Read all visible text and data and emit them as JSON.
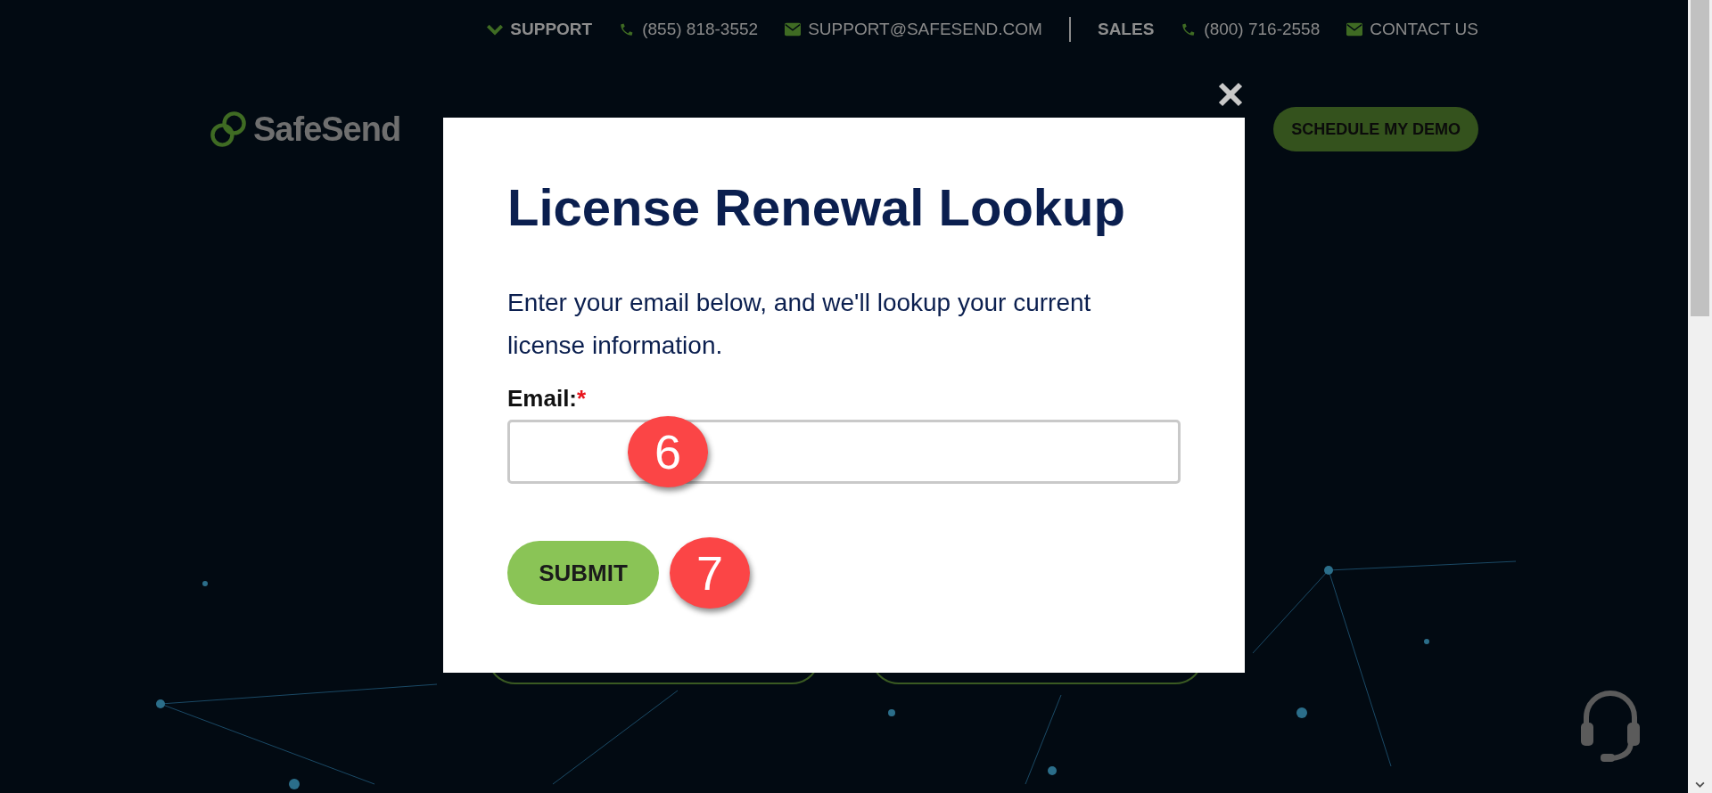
{
  "topbar": [
    {
      "kind": "toggle",
      "text": "SUPPORT"
    },
    {
      "kind": "phone",
      "text": "(855) 818-3552"
    },
    {
      "kind": "email",
      "text": "SUPPORT@SAFESEND.COM"
    },
    {
      "kind": "divider"
    },
    {
      "kind": "label",
      "text": "SALES"
    },
    {
      "kind": "phone",
      "text": "(800) 716-2558"
    },
    {
      "kind": "email",
      "text": "CONTACT US"
    }
  ],
  "header": {
    "logo": "SafeSend",
    "cta": "SCHEDULE MY DEMO"
  },
  "modal": {
    "title": "License Renewal Lookup",
    "text": "Enter your email below, and we'll lookup your current license information.",
    "field_label": "Email:",
    "required_mark": "*",
    "submit": "SUBMIT"
  },
  "annotations": [
    {
      "label": "6"
    },
    {
      "label": "7"
    }
  ]
}
